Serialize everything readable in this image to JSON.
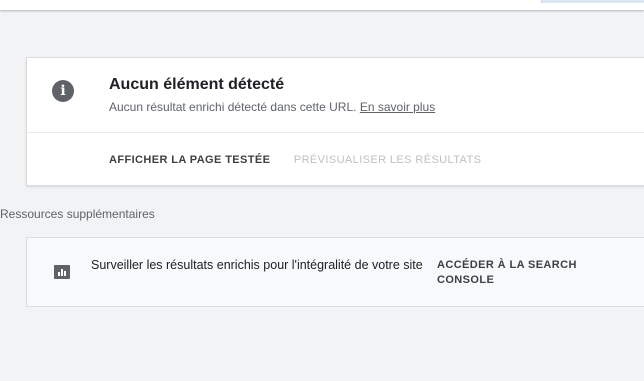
{
  "status_card": {
    "icon": "info-icon",
    "title": "Aucun élément détecté",
    "description": "Aucun résultat enrichi détecté dans cette URL.",
    "learn_more_link": "En savoir plus",
    "actions": {
      "view_tested_page": "AFFICHER LA PAGE TESTÉE",
      "preview_results": "PRÉVISUALISER LES RÉSULTATS"
    }
  },
  "resources": {
    "label": "Ressources supplémentaires",
    "items": [
      {
        "icon": "chart-icon",
        "text": "Surveiller les résultats enrichis pour l'intégralité de votre site",
        "action": "ACCÉDER À LA SEARCH CONSOLE"
      }
    ]
  },
  "colors": {
    "background": "#f1f3f4",
    "card": "#ffffff",
    "icon_gray": "#5f6368",
    "disabled_text": "#bdc1c6"
  }
}
